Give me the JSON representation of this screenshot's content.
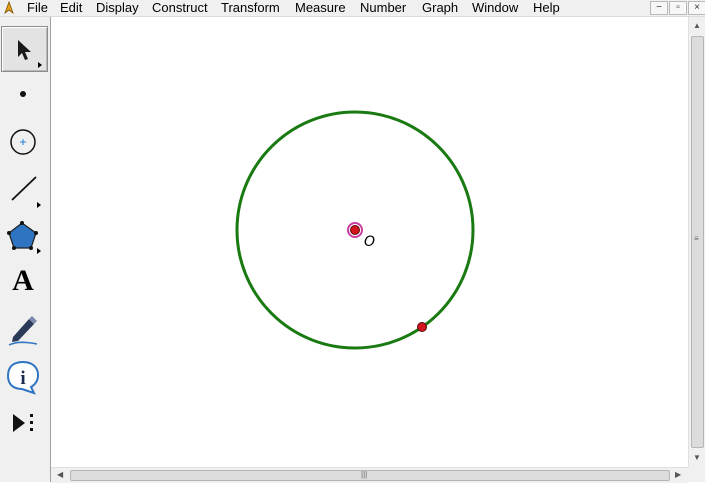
{
  "menubar": {
    "items": [
      "File",
      "Edit",
      "Display",
      "Construct",
      "Transform",
      "Measure",
      "Number",
      "Graph",
      "Window",
      "Help"
    ],
    "window_buttons": [
      "−",
      "▫",
      "×"
    ]
  },
  "toolbox": {
    "tools": [
      {
        "name": "arrow-select-tool",
        "icon": "arrow-icon",
        "selected": true
      },
      {
        "name": "point-tool",
        "icon": "point-icon"
      },
      {
        "name": "compass-tool",
        "icon": "circle-icon"
      },
      {
        "name": "straightedge-tool",
        "icon": "line-segment-icon"
      },
      {
        "name": "polygon-tool",
        "icon": "pentagon-icon"
      },
      {
        "name": "text-tool",
        "icon": "text-icon",
        "label": "A"
      },
      {
        "name": "marker-tool",
        "icon": "pen-icon"
      },
      {
        "name": "information-tool",
        "icon": "info-icon"
      },
      {
        "name": "custom-tool",
        "icon": "play-dots-icon"
      }
    ]
  },
  "canvas": {
    "center_label": "O",
    "colors": {
      "circle": "#1a7a12",
      "point": "#d2141e",
      "selection_halo": "#cc3ca0"
    }
  },
  "scrollbars": {
    "vertical_grip": "≡",
    "horizontal_grip": "|||"
  }
}
